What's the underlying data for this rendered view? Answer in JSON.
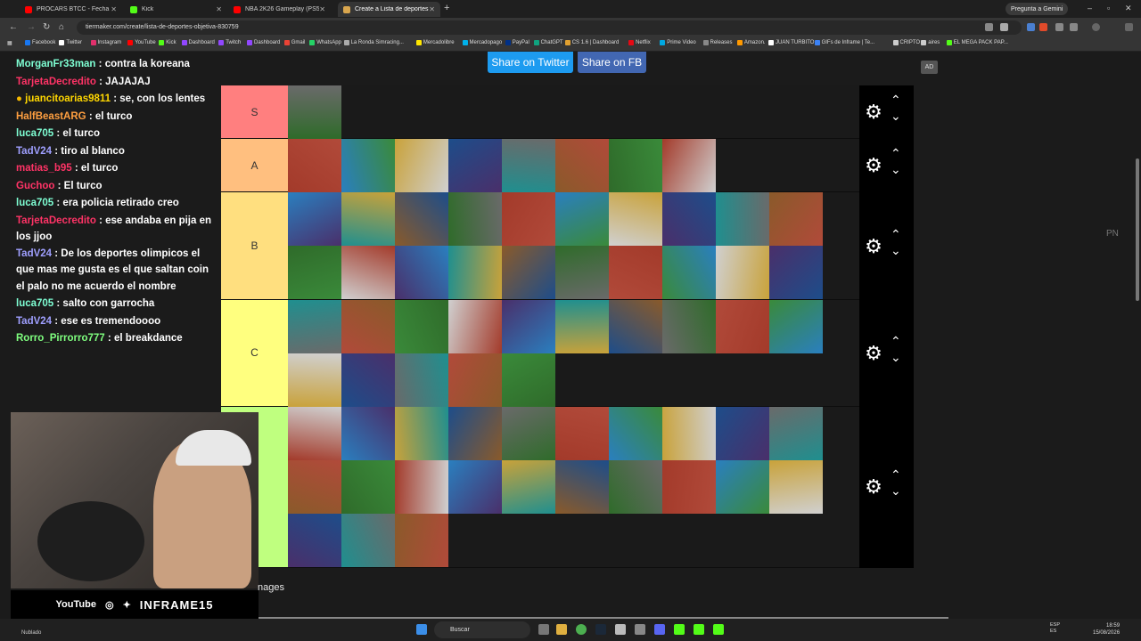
{
  "browser": {
    "tabs": [
      {
        "title": "PROCARS BTCC - Fecha 2 - Cm",
        "color": "#ff0000",
        "active": false
      },
      {
        "title": "Kick",
        "color": "#53fc18",
        "active": false
      },
      {
        "title": "NBA 2K26 Gameplay (PS5 UHD",
        "color": "#ff0000",
        "active": false
      },
      {
        "title": "Create a Lista de deportes (obj",
        "color": "#d9a64e",
        "active": true
      }
    ],
    "new_tab": "+",
    "gemini_label": "Pregunta a Gemini",
    "url": "tiermaker.com/create/lista-de-deportes-objetiva-830759",
    "bookmarks": [
      {
        "label": "Facebook",
        "color": "#1877f2"
      },
      {
        "label": "Twitter",
        "color": "#ffffff"
      },
      {
        "label": "Instagram",
        "color": "#e1306c"
      },
      {
        "label": "YouTube",
        "color": "#ff0000"
      },
      {
        "label": "Kick",
        "color": "#53fc18"
      },
      {
        "label": "Dashboard",
        "color": "#9147ff"
      },
      {
        "label": "Twitch",
        "color": "#9147ff"
      },
      {
        "label": "Dashboard",
        "color": "#9147ff"
      },
      {
        "label": "Gmail",
        "color": "#ea4335"
      },
      {
        "label": "WhatsApp",
        "color": "#25d366"
      },
      {
        "label": "La Ronda Simracing...",
        "color": "#aaaaaa"
      },
      {
        "label": "Mercadolibre",
        "color": "#ffe600"
      },
      {
        "label": "Mercadopago",
        "color": "#00b1ea"
      },
      {
        "label": "PayPal",
        "color": "#003087"
      },
      {
        "label": "ChatGPT",
        "color": "#10a37f"
      },
      {
        "label": "CS 1.6 | Dashboard",
        "color": "#e0a030"
      },
      {
        "label": "Netflix",
        "color": "#e50914"
      },
      {
        "label": "Prime Video",
        "color": "#00a8e1"
      },
      {
        "label": "Releases",
        "color": "#888888"
      },
      {
        "label": "Amazon.",
        "color": "#ff9900"
      },
      {
        "label": "JUAN TURBITO",
        "color": "#ffffff"
      },
      {
        "label": "GIFs de Inframe | Te...",
        "color": "#3b82f6"
      },
      {
        "label": "CRIPTO",
        "color": "#cccccc"
      },
      {
        "label": "aires",
        "color": "#cccccc"
      },
      {
        "label": "EL MEGA PACK PAP...",
        "color": "#53fc18"
      }
    ]
  },
  "page": {
    "share_twitter": "Share on Twitter",
    "share_fb": "Share on FB",
    "ad_badge": "AD",
    "side_label": "PN",
    "bottom_text": "nages"
  },
  "chat": [
    {
      "user": "MorganFr33man",
      "color": "#7fffd4",
      "text": ": contra la koreana"
    },
    {
      "user": "TarjetaDecredito",
      "color": "#ff3366",
      "text": ": JAJAJAJ"
    },
    {
      "user": "juancitoarias9811",
      "color": "#ffd700",
      "text": ": se, con los lentes",
      "badge": true
    },
    {
      "user": "HalfBeastARG",
      "color": "#ff9f40",
      "text": ": el turco"
    },
    {
      "user": "luca705",
      "color": "#7fffd4",
      "text": ": el turco"
    },
    {
      "user": "TadV24",
      "color": "#9f9fff",
      "text": ": tiro al blanco"
    },
    {
      "user": "matias_b95",
      "color": "#ff3366",
      "text": ": el turco"
    },
    {
      "user": "Guchoo",
      "color": "#ff3366",
      "text": ": El turco"
    },
    {
      "user": "luca705",
      "color": "#7fffd4",
      "text": ": era policia retirado creo"
    },
    {
      "user": "TarjetaDecredito",
      "color": "#ff3366",
      "text": ": ese andaba en pija en los jjoo"
    },
    {
      "user": "TadV24",
      "color": "#9f9fff",
      "text": ": De los deportes olimpicos el que mas me gusta es el que saltan coin el palo no me acuerdo el nombre"
    },
    {
      "user": "luca705",
      "color": "#7fffd4",
      "text": ": salto con garrocha"
    },
    {
      "user": "TadV24",
      "color": "#9f9fff",
      "text": ": ese es tremendoooo"
    },
    {
      "user": "Rorro_Pirrorro777",
      "color": "#7fff7f",
      "text": ": el breakdance"
    }
  ],
  "tiers": [
    {
      "label": "S",
      "color": "#ff7f7f",
      "rows": 1,
      "count": 1
    },
    {
      "label": "A",
      "color": "#ffbf7f",
      "rows": 1,
      "count": 8
    },
    {
      "label": "B",
      "color": "#ffdf7f",
      "rows": 2,
      "count": 20
    },
    {
      "label": "C",
      "color": "#ffff7f",
      "rows": 2,
      "count": 15
    },
    {
      "label": "",
      "color": "#bfff7f",
      "rows": 3,
      "count": 23
    }
  ],
  "thumb_colors": [
    "#2f6b2a",
    "#a33a2a",
    "#2a7fbf",
    "#c9a23a",
    "#1d4d8a",
    "#6a6a6a",
    "#b14a3a",
    "#3a8a3a",
    "#d0d0d0",
    "#4a2f6a",
    "#1f8f8f",
    "#8a5a2a"
  ],
  "webcam": {
    "youtube": "YouTube",
    "instagram_icon": "instagram-icon",
    "twitter_icon": "twitter-icon",
    "handle": "INFRAME15"
  },
  "taskbar": {
    "weather": "Nublado",
    "search": "Buscar",
    "lang_line1": "ESP",
    "lang_line2": "ES",
    "time": "18:59",
    "date": "15/08/2026"
  }
}
